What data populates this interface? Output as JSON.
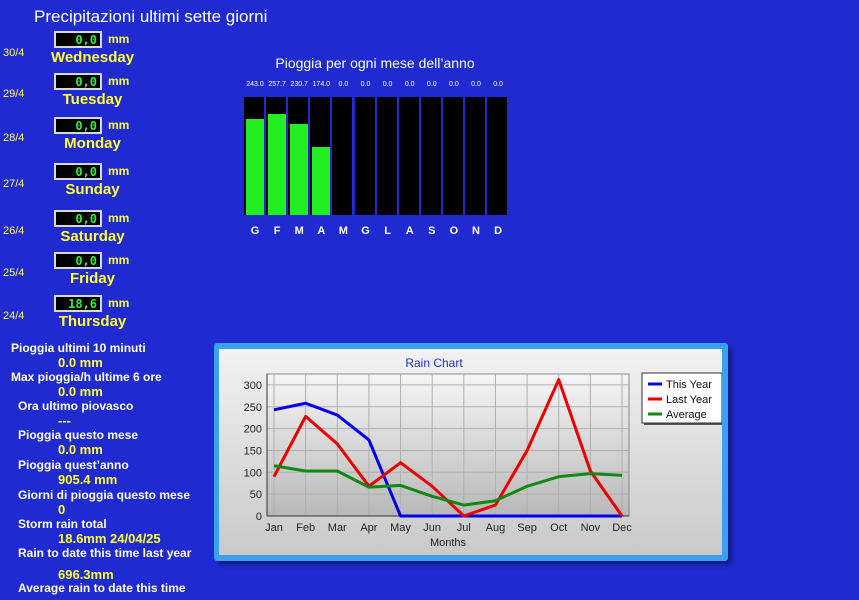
{
  "page_title": "Precipitazioni  ultimi sette giorni",
  "days": [
    {
      "date": "30/4",
      "value": "0,0",
      "unit": "mm",
      "name": "Wednesday"
    },
    {
      "date": "29/4",
      "value": "0,0",
      "unit": "mm",
      "name": "Tuesday"
    },
    {
      "date": "28/4",
      "value": "0,0",
      "unit": "mm",
      "name": "Monday"
    },
    {
      "date": "27/4",
      "value": "0,0",
      "unit": "mm",
      "name": "Sunday"
    },
    {
      "date": "26/4",
      "value": "0,0",
      "unit": "mm",
      "name": "Saturday"
    },
    {
      "date": "25/4",
      "value": "0,0",
      "unit": "mm",
      "name": "Friday"
    },
    {
      "date": "24/4",
      "value": "18,6",
      "unit": "mm",
      "name": "Thursday"
    }
  ],
  "month_chart": {
    "title": "Pioggia per ogni mese dell’anno",
    "labels": [
      "G",
      "F",
      "M",
      "A",
      "M",
      "G",
      "L",
      "A",
      "S",
      "O",
      "N",
      "D"
    ],
    "value_labels": [
      "243.0",
      "257.7",
      "230.7",
      "174.0",
      "0.0",
      "0.0",
      "0.0",
      "0.0",
      "0.0",
      "0.0",
      "0.0",
      "0.0"
    ],
    "values": [
      243.0,
      257.7,
      230.7,
      174.0,
      0,
      0,
      0,
      0,
      0,
      0,
      0,
      0
    ],
    "max": 300
  },
  "stats": {
    "rain_10min_label": "Pioggia ultimi 10 minuti",
    "rain_10min_value": "0.0 mm",
    "max_rate_label": "Max pioggia/h ultime 6 ore",
    "max_rate_value": "0.0 mm",
    "last_rain_label": "Ora ultimo piovasco",
    "last_rain_value": "---",
    "month_rain_label": "Pioggia questo mese",
    "month_rain_value": "0.0 mm",
    "year_rain_label": "Pioggia quest’anno",
    "year_rain_value": "905.4 mm",
    "rain_days_label": "Giorni di pioggia questo mese",
    "rain_days_value": "0",
    "storm_label": "Storm rain total",
    "storm_value": "18.6mm 24/04/25",
    "last_year_label": "Rain to date this time last year",
    "last_year_value": "696.3mm",
    "average_label": "Average rain to date this time"
  },
  "colors": {
    "background": "#1f2ad0",
    "this_year": "#0000ee",
    "last_year": "#ee0000",
    "average": "#118811"
  },
  "chart_data": {
    "type": "line",
    "title": "Rain Chart",
    "xlabel": "Months",
    "ylabel": "",
    "categories": [
      "Jan",
      "Feb",
      "Mar",
      "Apr",
      "May",
      "Jun",
      "Jul",
      "Aug",
      "Sep",
      "Oct",
      "Nov",
      "Dec"
    ],
    "ylim": [
      0,
      325
    ],
    "yticks": [
      0,
      50,
      100,
      150,
      200,
      250,
      300
    ],
    "grid": true,
    "legend": "top-right",
    "series": [
      {
        "name": "This Year",
        "color": "#0000ee",
        "values": [
          243,
          258,
          231,
          174,
          0,
          0,
          0,
          0,
          0,
          0,
          0,
          0
        ]
      },
      {
        "name": "Last Year",
        "color": "#ee0000",
        "values": [
          90,
          228,
          165,
          68,
          122,
          68,
          0,
          25,
          150,
          312,
          103,
          0
        ]
      },
      {
        "name": "Average",
        "color": "#118811",
        "values": [
          115,
          103,
          103,
          66,
          70,
          45,
          25,
          35,
          68,
          90,
          97,
          93
        ]
      }
    ]
  }
}
